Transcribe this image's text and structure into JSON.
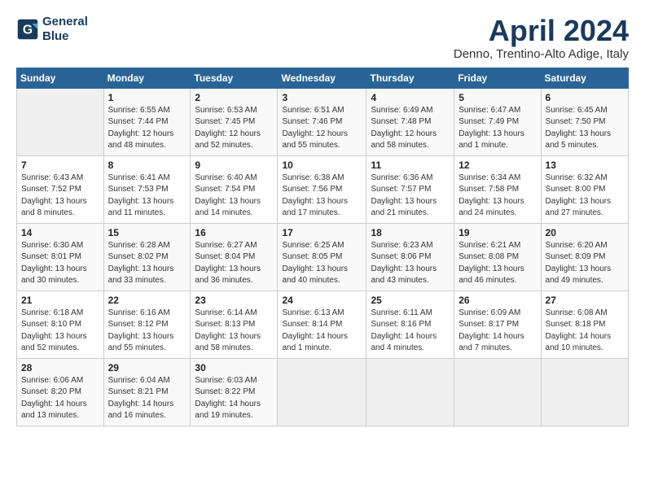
{
  "header": {
    "logo_line1": "General",
    "logo_line2": "Blue",
    "month_title": "April 2024",
    "subtitle": "Denno, Trentino-Alto Adige, Italy"
  },
  "weekdays": [
    "Sunday",
    "Monday",
    "Tuesday",
    "Wednesday",
    "Thursday",
    "Friday",
    "Saturday"
  ],
  "weeks": [
    [
      {
        "day": "",
        "sunrise": "",
        "sunset": "",
        "daylight": ""
      },
      {
        "day": "1",
        "sunrise": "Sunrise: 6:55 AM",
        "sunset": "Sunset: 7:44 PM",
        "daylight": "Daylight: 12 hours and 48 minutes."
      },
      {
        "day": "2",
        "sunrise": "Sunrise: 6:53 AM",
        "sunset": "Sunset: 7:45 PM",
        "daylight": "Daylight: 12 hours and 52 minutes."
      },
      {
        "day": "3",
        "sunrise": "Sunrise: 6:51 AM",
        "sunset": "Sunset: 7:46 PM",
        "daylight": "Daylight: 12 hours and 55 minutes."
      },
      {
        "day": "4",
        "sunrise": "Sunrise: 6:49 AM",
        "sunset": "Sunset: 7:48 PM",
        "daylight": "Daylight: 12 hours and 58 minutes."
      },
      {
        "day": "5",
        "sunrise": "Sunrise: 6:47 AM",
        "sunset": "Sunset: 7:49 PM",
        "daylight": "Daylight: 13 hours and 1 minute."
      },
      {
        "day": "6",
        "sunrise": "Sunrise: 6:45 AM",
        "sunset": "Sunset: 7:50 PM",
        "daylight": "Daylight: 13 hours and 5 minutes."
      }
    ],
    [
      {
        "day": "7",
        "sunrise": "Sunrise: 6:43 AM",
        "sunset": "Sunset: 7:52 PM",
        "daylight": "Daylight: 13 hours and 8 minutes."
      },
      {
        "day": "8",
        "sunrise": "Sunrise: 6:41 AM",
        "sunset": "Sunset: 7:53 PM",
        "daylight": "Daylight: 13 hours and 11 minutes."
      },
      {
        "day": "9",
        "sunrise": "Sunrise: 6:40 AM",
        "sunset": "Sunset: 7:54 PM",
        "daylight": "Daylight: 13 hours and 14 minutes."
      },
      {
        "day": "10",
        "sunrise": "Sunrise: 6:38 AM",
        "sunset": "Sunset: 7:56 PM",
        "daylight": "Daylight: 13 hours and 17 minutes."
      },
      {
        "day": "11",
        "sunrise": "Sunrise: 6:36 AM",
        "sunset": "Sunset: 7:57 PM",
        "daylight": "Daylight: 13 hours and 21 minutes."
      },
      {
        "day": "12",
        "sunrise": "Sunrise: 6:34 AM",
        "sunset": "Sunset: 7:58 PM",
        "daylight": "Daylight: 13 hours and 24 minutes."
      },
      {
        "day": "13",
        "sunrise": "Sunrise: 6:32 AM",
        "sunset": "Sunset: 8:00 PM",
        "daylight": "Daylight: 13 hours and 27 minutes."
      }
    ],
    [
      {
        "day": "14",
        "sunrise": "Sunrise: 6:30 AM",
        "sunset": "Sunset: 8:01 PM",
        "daylight": "Daylight: 13 hours and 30 minutes."
      },
      {
        "day": "15",
        "sunrise": "Sunrise: 6:28 AM",
        "sunset": "Sunset: 8:02 PM",
        "daylight": "Daylight: 13 hours and 33 minutes."
      },
      {
        "day": "16",
        "sunrise": "Sunrise: 6:27 AM",
        "sunset": "Sunset: 8:04 PM",
        "daylight": "Daylight: 13 hours and 36 minutes."
      },
      {
        "day": "17",
        "sunrise": "Sunrise: 6:25 AM",
        "sunset": "Sunset: 8:05 PM",
        "daylight": "Daylight: 13 hours and 40 minutes."
      },
      {
        "day": "18",
        "sunrise": "Sunrise: 6:23 AM",
        "sunset": "Sunset: 8:06 PM",
        "daylight": "Daylight: 13 hours and 43 minutes."
      },
      {
        "day": "19",
        "sunrise": "Sunrise: 6:21 AM",
        "sunset": "Sunset: 8:08 PM",
        "daylight": "Daylight: 13 hours and 46 minutes."
      },
      {
        "day": "20",
        "sunrise": "Sunrise: 6:20 AM",
        "sunset": "Sunset: 8:09 PM",
        "daylight": "Daylight: 13 hours and 49 minutes."
      }
    ],
    [
      {
        "day": "21",
        "sunrise": "Sunrise: 6:18 AM",
        "sunset": "Sunset: 8:10 PM",
        "daylight": "Daylight: 13 hours and 52 minutes."
      },
      {
        "day": "22",
        "sunrise": "Sunrise: 6:16 AM",
        "sunset": "Sunset: 8:12 PM",
        "daylight": "Daylight: 13 hours and 55 minutes."
      },
      {
        "day": "23",
        "sunrise": "Sunrise: 6:14 AM",
        "sunset": "Sunset: 8:13 PM",
        "daylight": "Daylight: 13 hours and 58 minutes."
      },
      {
        "day": "24",
        "sunrise": "Sunrise: 6:13 AM",
        "sunset": "Sunset: 8:14 PM",
        "daylight": "Daylight: 14 hours and 1 minute."
      },
      {
        "day": "25",
        "sunrise": "Sunrise: 6:11 AM",
        "sunset": "Sunset: 8:16 PM",
        "daylight": "Daylight: 14 hours and 4 minutes."
      },
      {
        "day": "26",
        "sunrise": "Sunrise: 6:09 AM",
        "sunset": "Sunset: 8:17 PM",
        "daylight": "Daylight: 14 hours and 7 minutes."
      },
      {
        "day": "27",
        "sunrise": "Sunrise: 6:08 AM",
        "sunset": "Sunset: 8:18 PM",
        "daylight": "Daylight: 14 hours and 10 minutes."
      }
    ],
    [
      {
        "day": "28",
        "sunrise": "Sunrise: 6:06 AM",
        "sunset": "Sunset: 8:20 PM",
        "daylight": "Daylight: 14 hours and 13 minutes."
      },
      {
        "day": "29",
        "sunrise": "Sunrise: 6:04 AM",
        "sunset": "Sunset: 8:21 PM",
        "daylight": "Daylight: 14 hours and 16 minutes."
      },
      {
        "day": "30",
        "sunrise": "Sunrise: 6:03 AM",
        "sunset": "Sunset: 8:22 PM",
        "daylight": "Daylight: 14 hours and 19 minutes."
      },
      {
        "day": "",
        "sunrise": "",
        "sunset": "",
        "daylight": ""
      },
      {
        "day": "",
        "sunrise": "",
        "sunset": "",
        "daylight": ""
      },
      {
        "day": "",
        "sunrise": "",
        "sunset": "",
        "daylight": ""
      },
      {
        "day": "",
        "sunrise": "",
        "sunset": "",
        "daylight": ""
      }
    ]
  ]
}
